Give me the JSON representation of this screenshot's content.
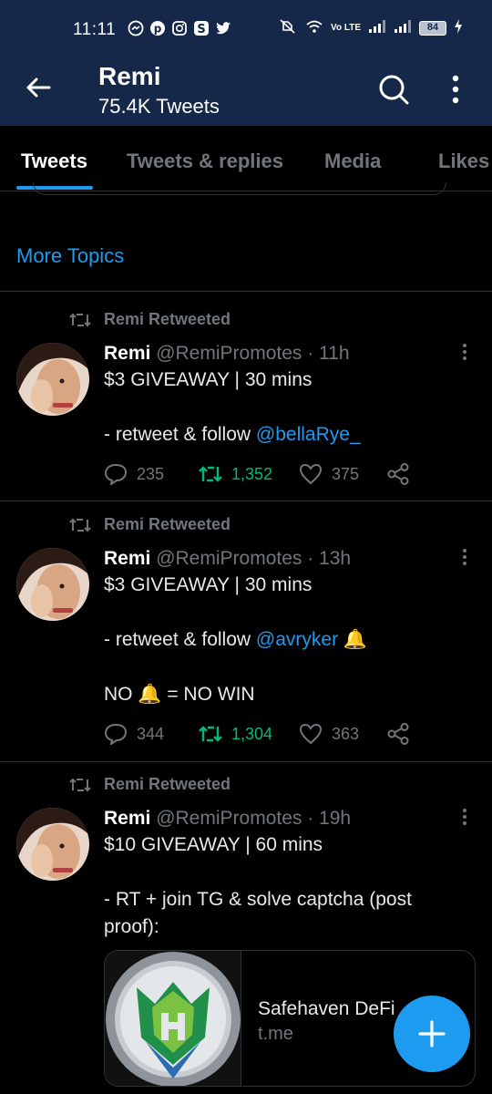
{
  "status_bar": {
    "time": "11:11",
    "battery": "84",
    "network": "Vo LTE"
  },
  "header": {
    "name": "Remi",
    "tweet_count": "75.4K Tweets"
  },
  "tabs": [
    {
      "label": "Tweets",
      "active": true
    },
    {
      "label": "Tweets & replies",
      "active": false
    },
    {
      "label": "Media",
      "active": false
    },
    {
      "label": "Likes",
      "active": false
    }
  ],
  "more_topics": "More Topics",
  "tweets": [
    {
      "retweeted_by": "Remi Retweeted",
      "name": "Remi",
      "handle": "@RemiPromotes",
      "time": "· 11h",
      "line1": "$3 GIVEAWAY | 30 mins",
      "line2_prefix": "- retweet & follow ",
      "line2_mention": "@bellaRye_",
      "replies": "235",
      "retweets": "1,352",
      "likes": "375"
    },
    {
      "retweeted_by": "Remi Retweeted",
      "name": "Remi",
      "handle": "@RemiPromotes",
      "time": "· 13h",
      "line1": "$3 GIVEAWAY | 30 mins",
      "line2_prefix": "- retweet & follow ",
      "line2_mention": "@avryker",
      "line2_suffix": " 🔔",
      "line3": "NO 🔔 = NO WIN",
      "replies": "344",
      "retweets": "1,304",
      "likes": "363"
    },
    {
      "retweeted_by": "Remi Retweeted",
      "name": "Remi",
      "handle": "@RemiPromotes",
      "time": "· 19h",
      "line1": "$10 GIVEAWAY | 60 mins",
      "line2": "- RT + join TG & solve captcha (post",
      "line3": "proof):",
      "card": {
        "title": "Safehaven DeFi",
        "domain": "t.me"
      }
    }
  ],
  "colors": {
    "header_bg": "#15284a",
    "accent": "#1d9bf0",
    "retweet_green": "#00ba7c",
    "muted": "#71767b"
  }
}
